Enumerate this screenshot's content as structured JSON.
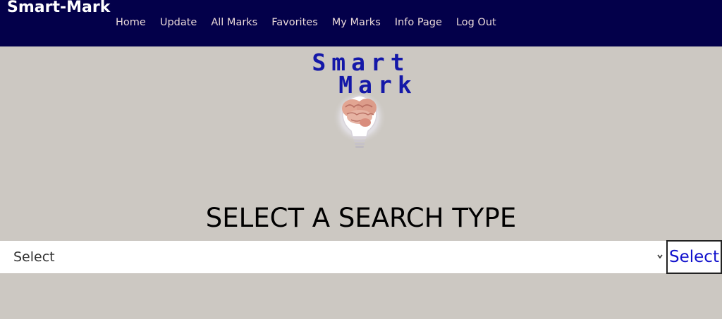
{
  "nav": {
    "brand": "Smart-Mark",
    "links": [
      "Home",
      "Update",
      "All Marks",
      "Favorites",
      "My Marks",
      "Info Page",
      "Log Out"
    ]
  },
  "logo": {
    "line1": "Smart",
    "line2": "Mark",
    "text_color": "#1418a8",
    "icon": "brain-lightbulb-icon"
  },
  "main": {
    "title": "SELECT A SEARCH TYPE",
    "select_value": "Select",
    "select_button": "Select"
  },
  "colors": {
    "navbar_bg": "#03004a",
    "page_bg": "#ccc8c2",
    "nav_link": "#e9d8d8",
    "button_text": "#1010cc"
  }
}
